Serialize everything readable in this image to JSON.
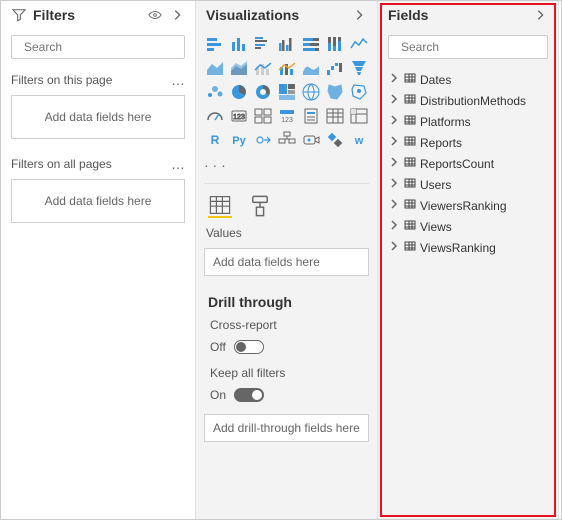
{
  "filters": {
    "title": "Filters",
    "search_placeholder": "Search",
    "section_page": "Filters on this page",
    "section_allpages": "Filters on all pages",
    "drop_text": "Add data fields here"
  },
  "viz": {
    "title": "Visualizations",
    "values_label": "Values",
    "values_drop": "Add data fields here",
    "drill_title": "Drill through",
    "cross_report_label": "Cross-report",
    "cross_report_state": "Off",
    "keep_filters_label": "Keep all filters",
    "keep_filters_state": "On",
    "drill_drop": "Add drill-through fields here",
    "icon_names": [
      "stacked-bar",
      "stacked-column",
      "clustered-bar",
      "clustered-column",
      "100-stacked-bar",
      "100-stacked-column",
      "line",
      "area",
      "stacked-area",
      "line-bar",
      "line-column",
      "ribbon",
      "waterfall",
      "funnel",
      "scatter",
      "pie",
      "donut",
      "treemap",
      "map",
      "filled-map",
      "shape-map",
      "gauge",
      "card",
      "multi-row-card",
      "kpi",
      "slicer",
      "table",
      "matrix",
      "r-visual",
      "py-visual",
      "key-influencers",
      "decomposition",
      "qna",
      "paginated",
      "arcgis"
    ]
  },
  "fields": {
    "title": "Fields",
    "search_placeholder": "Search",
    "tables": [
      "Dates",
      "DistributionMethods",
      "Platforms",
      "Reports",
      "ReportsCount",
      "Users",
      "ViewersRanking",
      "Views",
      "ViewsRanking"
    ]
  }
}
